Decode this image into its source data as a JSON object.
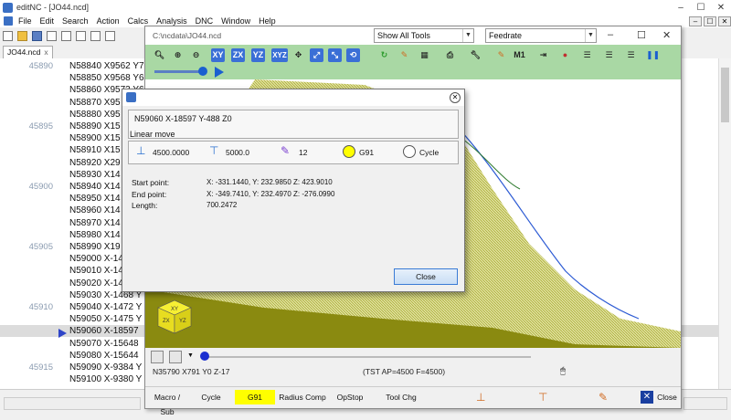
{
  "window": {
    "title": "editNC - [JO44.ncd]",
    "minimize": "–",
    "maximize": "☐",
    "close": "✕"
  },
  "menu": [
    "File",
    "Edit",
    "Search",
    "Action",
    "Calcs",
    "Analysis",
    "DNC",
    "Window",
    "Help"
  ],
  "tab": {
    "label": "JO44.ncd",
    "close": "x"
  },
  "editor": {
    "lines": [
      {
        "num": "45890",
        "code": "N58840 X9562 Y7"
      },
      {
        "num": "",
        "code": "N58850 X9568 Y6"
      },
      {
        "num": "",
        "code": "N58860 X9573 Y6"
      },
      {
        "num": "",
        "code": "N58870 X95"
      },
      {
        "num": "",
        "code": "N58880 X95"
      },
      {
        "num": "45895",
        "code": "N58890 X15"
      },
      {
        "num": "",
        "code": "N58900 X15"
      },
      {
        "num": "",
        "code": "N58910 X15"
      },
      {
        "num": "",
        "code": "N58920 X29"
      },
      {
        "num": "",
        "code": "N58930 X14"
      },
      {
        "num": "45900",
        "code": "N58940 X14"
      },
      {
        "num": "",
        "code": "N58950 X14"
      },
      {
        "num": "",
        "code": "N58960 X14"
      },
      {
        "num": "",
        "code": "N58970 X14"
      },
      {
        "num": "",
        "code": "N58980 X14"
      },
      {
        "num": "45905",
        "code": "N58990 X19"
      },
      {
        "num": "",
        "code": "N59000 X-14"
      },
      {
        "num": "",
        "code": "N59010 X-14"
      },
      {
        "num": "",
        "code": "N59020 X-14"
      },
      {
        "num": "",
        "code": "N59030 X-1468 Y"
      },
      {
        "num": "45910",
        "code": "N59040 X-1472 Y"
      },
      {
        "num": "",
        "code": "N59050 X-1475 Y"
      },
      {
        "num": "",
        "code": "N59060 X-18597"
      },
      {
        "num": "",
        "code": "N59070 X-15648"
      },
      {
        "num": "",
        "code": "N59080 X-15644"
      },
      {
        "num": "45915",
        "code": "N59090 X-9384 Y"
      },
      {
        "num": "",
        "code": "N59100 X-9380 Y"
      }
    ],
    "current_index": 22
  },
  "viewer": {
    "path": "C:\\ncdata\\JO44.ncd",
    "filter_value": "Show All Tools",
    "color_by_value": "Feedrate",
    "minimize": "–",
    "maximize": "☐",
    "close": "✕",
    "view_buttons": [
      "XY",
      "ZX",
      "YZ",
      "XYZ"
    ],
    "view_cube": {
      "top": "XY",
      "front": "ZX",
      "side": "YZ"
    },
    "status_block": "N35790 X791 Y0 Z-17",
    "status_info": "(TST AP=4500 F=4500)",
    "flags": [
      {
        "label": "Macro / Sub",
        "on": false
      },
      {
        "label": "Cycle",
        "on": false
      },
      {
        "label": "G91",
        "on": true
      },
      {
        "label": "Radius Comp",
        "on": false
      },
      {
        "label": "OpStop",
        "on": false
      },
      {
        "label": "Tool Chg",
        "on": false
      }
    ],
    "close_label": "Close"
  },
  "dialog": {
    "block": "N59060 X-18597 Y-488 Z0",
    "move_type": "Linear move",
    "feed": "4500.0000",
    "speed": "5000.0",
    "tool": "12",
    "mode": "G91",
    "cycle": "Cycle",
    "start_label": "Start point:",
    "start_value": "X: -331.1440,  Y: 232.9850  Z: 423.9010",
    "end_label": "End point:",
    "end_value": "X: -349.7410,  Y: 232.4970  Z: -276.0990",
    "length_label": "Length:",
    "length_value": "700.2472",
    "close_label": "Close"
  },
  "colors": {
    "toolbar_green": "#a9d8a4",
    "surface": "#8a8a10",
    "mesh": "#c8c84a",
    "highlight": "#ffff00",
    "accent": "#3a6fd6"
  }
}
